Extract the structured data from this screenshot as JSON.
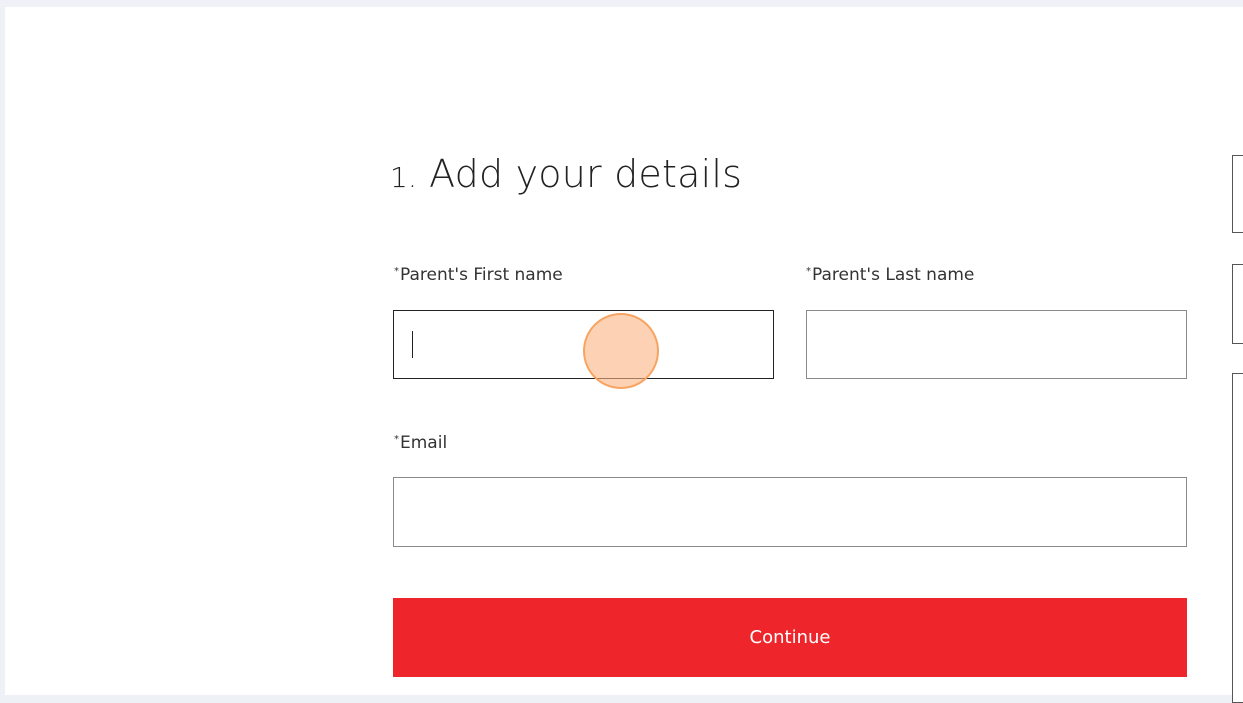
{
  "form": {
    "step_number": "1.",
    "title": "Add your details",
    "required_marker": "*",
    "first_name_label": "Parent's First name",
    "last_name_label": "Parent's Last name",
    "email_label": "Email",
    "first_name_value": "",
    "last_name_value": "",
    "email_value": "",
    "continue_label": "Continue"
  },
  "colors": {
    "accent": "#ee262c",
    "background": "#eef2f7"
  }
}
